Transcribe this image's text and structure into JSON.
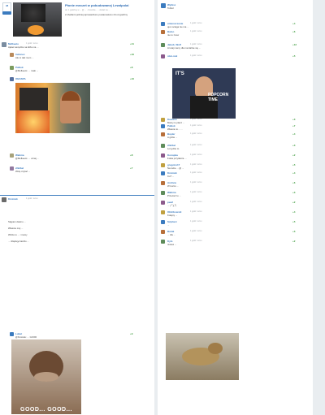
{
  "header": {
    "badge_count": "48",
    "title": "Płonie meczet w pobudowanej Lewdpolai",
    "subtitle": "2 chwilami później wprowadzono postanowiono 24 od godziny",
    "meta": "ok. 1 godzinę w ... @ ... - Kosmita ... - dodać na ..."
  },
  "left_comments": [
    {
      "name": "Mefkeeto",
      "time": "1 godz. temu",
      "text": "Ajatei wszędzie na łóżku na ...",
      "votes": "+11"
    },
    {
      "name": "Indonex",
      "time": "1 godz. temu",
      "text": "Ale to taki mem ...",
      "votes": "+10"
    },
    {
      "name": "Palkok",
      "time": "1 godz. temu",
      "text": "@Mefkeeto: ... mało ...",
      "votes": "+8"
    },
    {
      "name": "OBASPA",
      "time": "1 godz. temu",
      "text": "@Radiolos: ...",
      "votes": "+10"
    },
    {
      "name": "Wahma",
      "time": "1 godz. temu",
      "text": "@Mefkeeto: ... uznaj ...",
      "votes": "+8"
    },
    {
      "name": "zNeSat",
      "time": "1 godz. temu",
      "text": "Wolę czytać ...",
      "votes": "+7"
    }
  ],
  "left_long": {
    "name": "Kmiotek",
    "time": "1 godz. temu",
    "text": "Stąpam dawno ...\n\nWlasnie moj ...\n\nWidze to ... i mowy\n\n... dziękuję bardzo ..."
  },
  "left_bottom": {
    "name": "Lubet",
    "time": "1 godz. temu",
    "text": "@Kmiotek: ... GOOD",
    "votes": "+9",
    "caption": "GOOD... GOOD..."
  },
  "right_top": {
    "name": "Wybisz",
    "time": "1 godz. temu",
    "text": "Tobisz"
  },
  "right_comments": [
    {
      "name": "umieszczenie",
      "time": "1 godz. temu",
      "text": "ojon sciaga nie ma ...",
      "votes": "+4"
    },
    {
      "name": "Baloo",
      "time": "1 godz. temu",
      "text": "nie to znow",
      "votes": "+6"
    },
    {
      "name": "Jakub_Wolf",
      "time": "1 godz. temu",
      "text": "A tutaj mamy dla mentalnie się ...",
      "votes": "+12"
    },
    {
      "name": "sbm-nek",
      "time": "1 godz. temu",
      "text": "",
      "votes": "+5"
    },
    {
      "name": "Kasiano",
      "time": "1 godz. temu",
      "text": "Mamy to płacz ...",
      "votes": "+3"
    },
    {
      "name": "Palkok",
      "time": "1 godz. temu",
      "text": "Wlasnie to... ...",
      "votes": "+7"
    },
    {
      "name": "Bupler",
      "time": "1 godz. temu",
      "text": "A gdzie ...",
      "votes": "+4"
    },
    {
      "name": "zNeSat",
      "time": "1 godz. temu",
      "text": "Lol gdzie to",
      "votes": "+3"
    },
    {
      "name": "Konopka",
      "time": "1 godz. temu",
      "text": "Fotka przytłacza ...",
      "votes": "+2"
    },
    {
      "name": "gregoire17",
      "time": "1 godz. temu",
      "text": "Na razie ... @ ...",
      "votes": "+5"
    },
    {
      "name": "Kmiotek",
      "time": "1 godz. temu",
      "text": "Co? ...",
      "votes": "+4"
    },
    {
      "name": "Andrew",
      "time": "1 godz. temu",
      "text": "W końcu ...",
      "votes": "+6"
    },
    {
      "name": "Wahma",
      "time": "1 godz. temu",
      "text": "Przecież to ...",
      "votes": "+3"
    },
    {
      "name": "pearl",
      "time": "1 godz. temu",
      "text": "... ( ͡° ͜ʖ ͡°)",
      "votes": "+2"
    },
    {
      "name": "Ołdzikowski",
      "time": "1 godz. temu",
      "text": "Kolejny ...",
      "votes": "+4"
    },
    {
      "name": "Sziplacz",
      "time": "1 godz. temu",
      "text": "...",
      "votes": "+5"
    },
    {
      "name": "Barak",
      "time": "1 godz. temu",
      "text": "... dla ...",
      "votes": "+3"
    },
    {
      "name": "Kylo",
      "time": "1 godz. temu",
      "text": "Jesteś ...",
      "votes": "+2"
    }
  ],
  "memes": {
    "its_popcorn_top": "IT'S",
    "its_popcorn_bottom": "POPCORN TIME",
    "good": "GOOD... GOOD..."
  },
  "colors": {
    "link": "#3b7bbf",
    "plus": "#3c9a3c",
    "minus": "#d9534f"
  }
}
